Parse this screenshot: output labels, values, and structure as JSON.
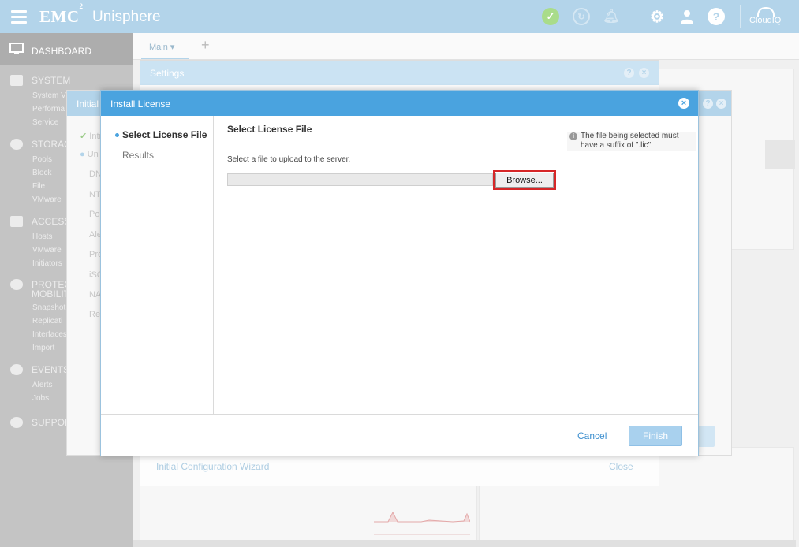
{
  "topbar": {
    "brand": "EMC",
    "brand_sup": "2",
    "product": "Unisphere",
    "icons": [
      "hamburger-icon",
      "health-check-icon",
      "jobs-icon",
      "bell-icon",
      "gear-icon",
      "user-icon",
      "help-icon",
      "cloudiq-icon"
    ],
    "cloudiq": "CloudIQ",
    "help": "?",
    "health": "✓"
  },
  "sidebar": {
    "dashboard": "DASHBOARD",
    "system": "SYSTEM",
    "system_items": [
      "System V",
      "Performa",
      "Service"
    ],
    "storage": "STORAG",
    "storage_items": [
      "Pools",
      "Block",
      "File",
      "VMware"
    ],
    "access": "ACCESS",
    "access_items": [
      "Hosts",
      "VMware",
      "Initiators"
    ],
    "protection": "PROTEC",
    "protection2": "MOBILIT",
    "protection_items": [
      "Snapshot",
      "Replicati",
      "Interfaces",
      "Import"
    ],
    "events": "EVENTS",
    "events_items": [
      "Alerts",
      "Jobs"
    ],
    "support": "SUPPOR"
  },
  "tabs": {
    "main": "Main",
    "add": "+"
  },
  "settings": {
    "title": "Settings",
    "footer_link": "Initial Configuration Wizard",
    "close": "Close"
  },
  "wizard": {
    "title": "Initial",
    "steps": [
      "Intr",
      "Un",
      "DN",
      "NT",
      "Po",
      "Ale",
      "Pro",
      "iSC",
      "NA",
      "Re"
    ]
  },
  "modal": {
    "title": "Install License",
    "steps": {
      "active": "Select License File",
      "results": "Results"
    },
    "content_title": "Select License File",
    "description": "Select a file to upload to the server.",
    "browse": "Browse...",
    "hint_line1": "The file being selected must",
    "hint_line2": "have a suffix of \".lic\".",
    "cancel": "Cancel",
    "finish": "Finish"
  },
  "colors": {
    "header": "#b3d4ea",
    "modal_header": "#4aa3df",
    "highlight": "#d62728",
    "link": "#3d8fcf"
  }
}
